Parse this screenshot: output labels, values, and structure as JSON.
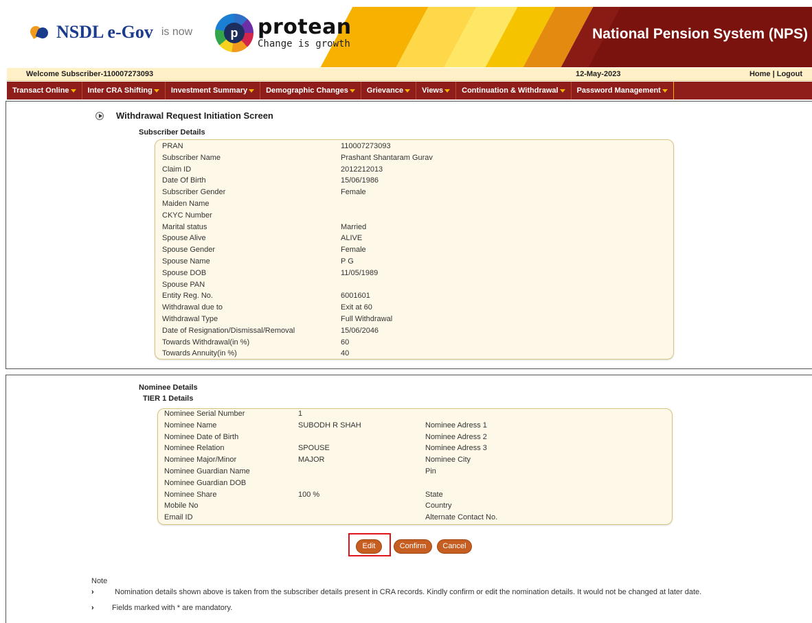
{
  "header": {
    "nsdl_brand": "NSDL e-Gov",
    "is_now": "is now",
    "protean_name": "protean",
    "protean_tagline": "Change is growth",
    "portal_title": "National Pension System (NPS)"
  },
  "welcome_bar": {
    "welcome_text": "Welcome Subscriber-110007273093",
    "date": "12-May-2023",
    "home_link": "Home",
    "separator": "|",
    "logout_link": "Logout"
  },
  "nav": {
    "items": [
      "Transact Online",
      "Inter CRA Shifting",
      "Investment Summary",
      "Demographic Changes",
      "Grievance",
      "Views",
      "Continuation & Withdrawal",
      "Password Management"
    ]
  },
  "screen": {
    "title": "Withdrawal Request Initiation Screen"
  },
  "subscriber": {
    "section_label": "Subscriber Details",
    "rows": [
      {
        "label": "PRAN",
        "value": "110007273093"
      },
      {
        "label": "Subscriber Name",
        "value": "Prashant Shantaram Gurav"
      },
      {
        "label": "Claim ID",
        "value": "2012212013"
      },
      {
        "label": "Date Of Birth",
        "value": "15/06/1986"
      },
      {
        "label": "Subscriber Gender",
        "value": "Female"
      },
      {
        "label": "Maiden Name",
        "value": ""
      },
      {
        "label": "CKYC Number",
        "value": ""
      },
      {
        "label": "Marital status",
        "value": "Married"
      },
      {
        "label": "Spouse Alive",
        "value": "ALIVE"
      },
      {
        "label": "Spouse Gender",
        "value": "Female"
      },
      {
        "label": "Spouse Name",
        "value": "P G"
      },
      {
        "label": "Spouse DOB",
        "value": "11/05/1989"
      },
      {
        "label": "Spouse PAN",
        "value": ""
      },
      {
        "label": "Entity Reg. No.",
        "value": "6001601"
      },
      {
        "label": "Withdrawal due to",
        "value": "Exit at 60"
      },
      {
        "label": "Withdrawal Type",
        "value": "Full Withdrawal"
      },
      {
        "label": "Date of Resignation/Dismissal/Removal",
        "value": "15/06/2046"
      },
      {
        "label": "Towards Withdrawal(in %)",
        "value": "60"
      },
      {
        "label": "Towards Annuity(in %)",
        "value": "40"
      }
    ]
  },
  "nominee": {
    "section_label": "Nominee Details",
    "tier_label": "TIER 1 Details",
    "rows": [
      {
        "label": "Nominee Serial Number",
        "value": "1",
        "label2": ""
      },
      {
        "label": "Nominee Name",
        "value": "SUBODH R SHAH",
        "label2": "Nominee Adress 1"
      },
      {
        "label": "Nominee Date of Birth",
        "value": "",
        "label2": "Nominee Adress 2"
      },
      {
        "label": "Nominee Relation",
        "value": "SPOUSE",
        "label2": "Nominee Adress 3"
      },
      {
        "label": "Nominee Major/Minor",
        "value": "MAJOR",
        "label2": "Nominee City"
      },
      {
        "label": "Nominee Guardian Name",
        "value": "",
        "label2": "Pin"
      },
      {
        "label": "Nominee Guardian DOB",
        "value": "",
        "label2": ""
      },
      {
        "label": "Nominee Share",
        "value": "100 %",
        "label2": "State"
      },
      {
        "label": "Mobile No",
        "value": "",
        "label2": "Country"
      },
      {
        "label": "Email ID",
        "value": "",
        "label2": "Alternate Contact No."
      }
    ]
  },
  "actions": {
    "edit": "Edit",
    "confirm": "Confirm",
    "cancel": "Cancel",
    "highlight_color": "#e0141a"
  },
  "note": {
    "title": "Note",
    "lines": [
      "Nomination details shown above is taken from the subscriber details present in CRA records. Kindly confirm or edit the nomination details. It would not be changed at later date.",
      "Fields marked with * are mandatory."
    ],
    "arrow_glyph": "›"
  },
  "colors": {
    "nav_bg": "#8f1e1a",
    "welcome_bg": "#fff0c8",
    "box_bg": "#fdf8e8",
    "button_bg": "#c65d21"
  }
}
